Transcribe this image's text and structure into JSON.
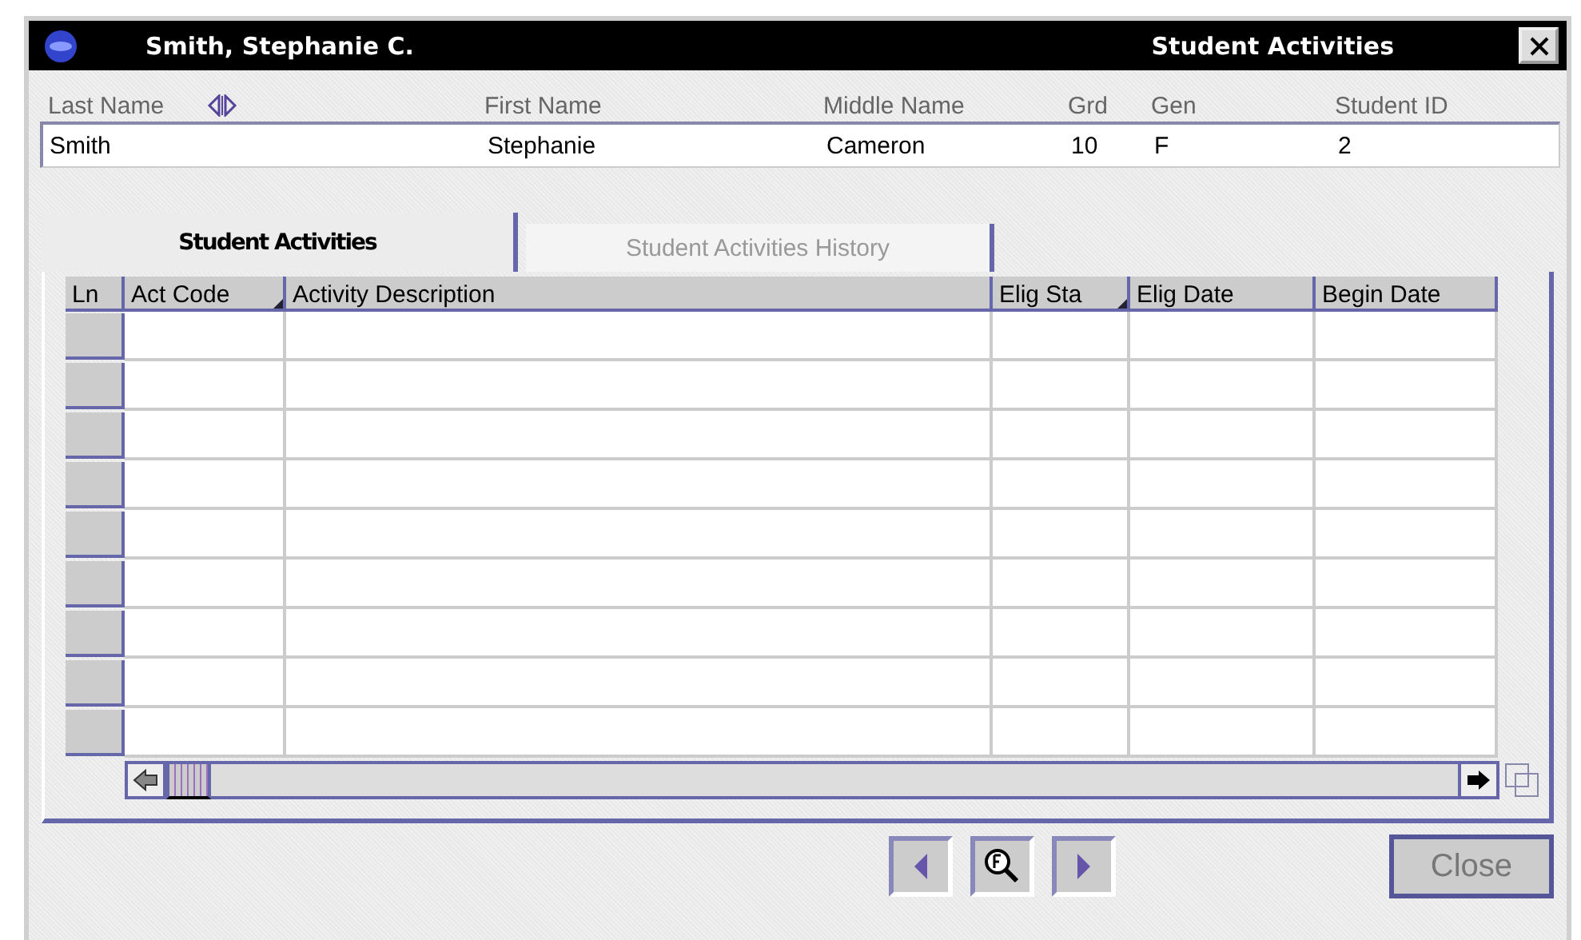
{
  "window": {
    "title": "Smith, Stephanie C.",
    "module": "Student Activities"
  },
  "student": {
    "fields": [
      {
        "label": "Last Name",
        "value": "Smith",
        "kind": "sortable"
      },
      {
        "label": "First Name",
        "value": "Stephanie",
        "kind": "plain"
      },
      {
        "label": "Middle Name",
        "value": "Cameron",
        "kind": "plain"
      },
      {
        "label": "Grd",
        "value": "10",
        "kind": "plain"
      },
      {
        "label": "Gen",
        "value": "F",
        "kind": "plain"
      },
      {
        "label": "Student ID",
        "value": "2",
        "kind": "plain"
      }
    ]
  },
  "tabs": [
    {
      "label": "Student Activities",
      "selected": true
    },
    {
      "label": "Student Activities History",
      "selected": false
    }
  ],
  "table": {
    "columns": [
      {
        "label": "Ln",
        "sortable": false
      },
      {
        "label": "Act Code",
        "sortable": true
      },
      {
        "label": "Activity Description",
        "sortable": false
      },
      {
        "label": "Elig Sta",
        "sortable": true
      },
      {
        "label": "Elig Date",
        "sortable": false
      },
      {
        "label": "Begin Date",
        "sortable": false
      }
    ]
  },
  "close_button": {
    "label": "Close",
    "disabled": true
  }
}
